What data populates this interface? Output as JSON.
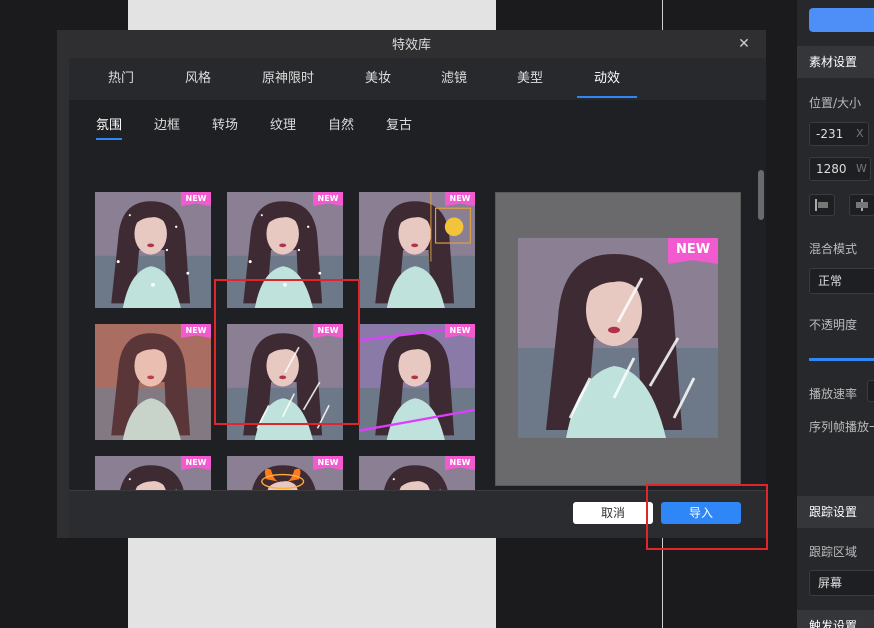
{
  "dialog": {
    "title": "特效库",
    "close_glyph": "✕",
    "categories": [
      {
        "label": "热门"
      },
      {
        "label": "风格"
      },
      {
        "label": "原神限时"
      },
      {
        "label": "美妆"
      },
      {
        "label": "滤镜"
      },
      {
        "label": "美型"
      },
      {
        "label": "动效"
      }
    ],
    "active_category": "动效",
    "subcategories": [
      {
        "label": "氛围"
      },
      {
        "label": "边框"
      },
      {
        "label": "转场"
      },
      {
        "label": "纹理"
      },
      {
        "label": "自然"
      },
      {
        "label": "复古"
      }
    ],
    "active_subcategory": "氛围",
    "thumbnails": [
      {
        "badge": "NEW",
        "effect": "sparkle-icon"
      },
      {
        "badge": "NEW",
        "effect": "sparkle-icon"
      },
      {
        "badge": "NEW",
        "effect": "moon-icon"
      },
      {
        "badge": "NEW",
        "effect": "glow-icon"
      },
      {
        "badge": "NEW",
        "effect": "meteor-icon",
        "selected": true
      },
      {
        "badge": "NEW",
        "effect": "laser-icon"
      },
      {
        "badge": "NEW",
        "effect": "sparkle-icon"
      },
      {
        "badge": "NEW",
        "effect": "devil-horns-icon"
      },
      {
        "badge": "NEW",
        "effect": "sparkle-icon"
      }
    ],
    "preview": {
      "badge": "NEW",
      "effect": "meteor-icon"
    },
    "footer": {
      "cancel_label": "取消",
      "import_label": "导入"
    }
  },
  "right_panel": {
    "material_settings": "素材设置",
    "position_size": "位置/大小",
    "x_value": "-231",
    "x_unit": "X",
    "w_value": "1280",
    "w_unit": "W",
    "blend_mode_label": "混合模式",
    "blend_mode_value": "正常",
    "opacity_label": "不透明度",
    "playback_speed_label": "播放速率",
    "sequence_playback_label": "序列帧播放一",
    "tracking_settings": "跟踪设置",
    "tracking_area_label": "跟踪区域",
    "tracking_area_value": "屏幕",
    "trigger_settings": "触发设置"
  },
  "colors": {
    "accent": "#2f86f7",
    "badge": "#f25bcf",
    "annotation": "#e0262b"
  }
}
